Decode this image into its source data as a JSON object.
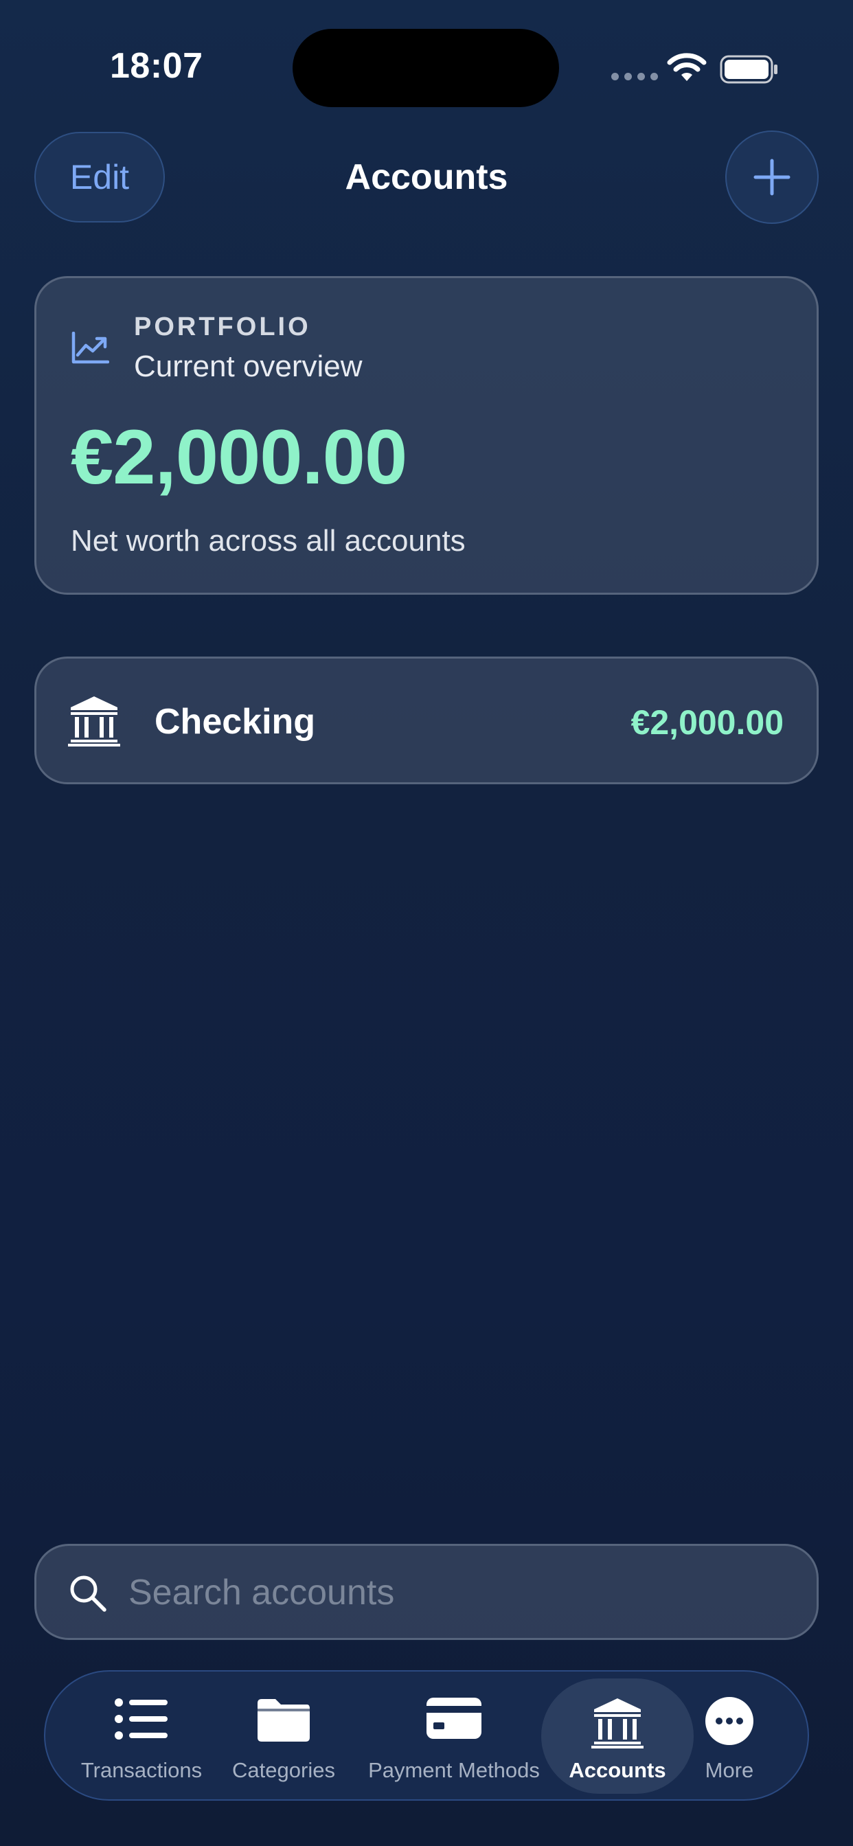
{
  "status_bar": {
    "time": "18:07"
  },
  "header": {
    "edit_label": "Edit",
    "title": "Accounts",
    "add_icon": "plus-icon"
  },
  "portfolio": {
    "label": "PORTFOLIO",
    "subtitle": "Current overview",
    "amount": "€2,000.00",
    "caption": "Net worth across all accounts",
    "icon": "chart-line-icon"
  },
  "accounts": [
    {
      "name": "Checking",
      "balance": "€2,000.00",
      "icon": "bank-icon"
    }
  ],
  "search": {
    "placeholder": "Search accounts",
    "value": ""
  },
  "tab_bar": {
    "tabs": [
      {
        "label": "Transactions",
        "icon": "list-icon",
        "active": false
      },
      {
        "label": "Categories",
        "icon": "folder-icon",
        "active": false
      },
      {
        "label": "Payment Methods",
        "icon": "credit-card-icon",
        "active": false
      },
      {
        "label": "Accounts",
        "icon": "bank-icon",
        "active": true
      },
      {
        "label": "More",
        "icon": "ellipsis-circle-icon",
        "active": false
      }
    ]
  },
  "colors": {
    "accent": "#7ea9f5",
    "amount_green": "#8ff2c9",
    "background": "#12223f"
  }
}
